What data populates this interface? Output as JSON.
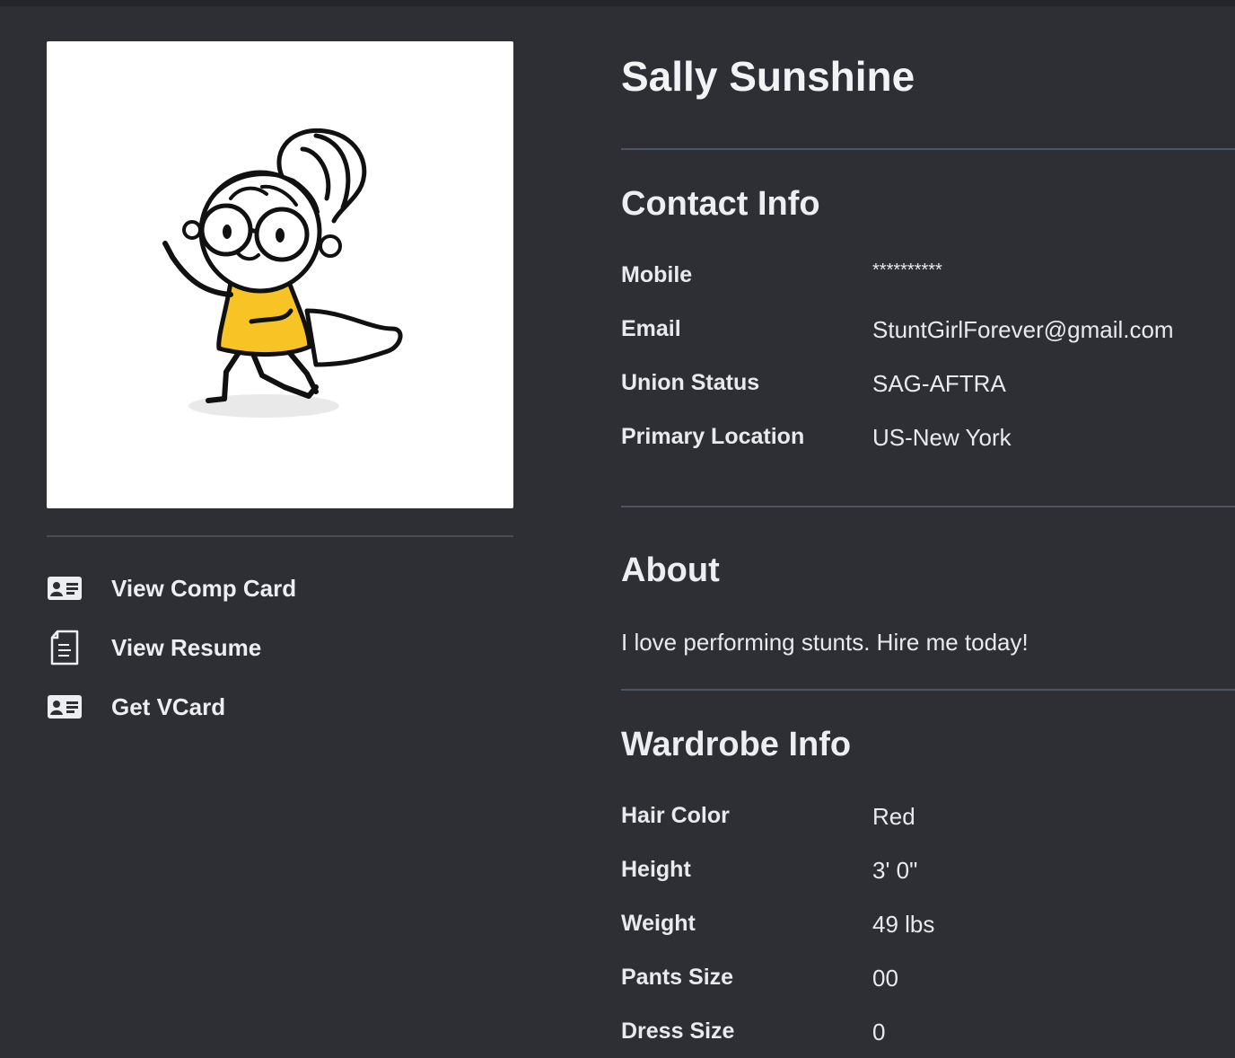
{
  "profile": {
    "name": "Sally Sunshine",
    "photo_icon": "superhero-girl-illustration"
  },
  "actions": [
    {
      "label": "View Comp Card",
      "icon": "id-card-icon"
    },
    {
      "label": "View Resume",
      "icon": "document-icon"
    },
    {
      "label": "Get VCard",
      "icon": "id-card-icon"
    }
  ],
  "contact": {
    "title": "Contact Info",
    "rows": [
      {
        "label": "Mobile",
        "value": "**********"
      },
      {
        "label": "Email",
        "value": "StuntGirlForever@gmail.com"
      },
      {
        "label": "Union Status",
        "value": "SAG-AFTRA"
      },
      {
        "label": "Primary Location",
        "value": "US-New York"
      }
    ]
  },
  "about": {
    "title": "About",
    "text": "I love performing stunts. Hire me today!"
  },
  "wardrobe": {
    "title": "Wardrobe Info",
    "rows": [
      {
        "label": "Hair Color",
        "value": "Red"
      },
      {
        "label": "Height",
        "value": "3' 0\""
      },
      {
        "label": "Weight",
        "value": "49 lbs"
      },
      {
        "label": "Pants Size",
        "value": "00"
      },
      {
        "label": "Dress Size",
        "value": "0"
      }
    ]
  },
  "colors": {
    "background": "#2e2f35",
    "text": "#e9eaed",
    "divider": "#4d5560",
    "accent_yellow": "#f7c325"
  }
}
